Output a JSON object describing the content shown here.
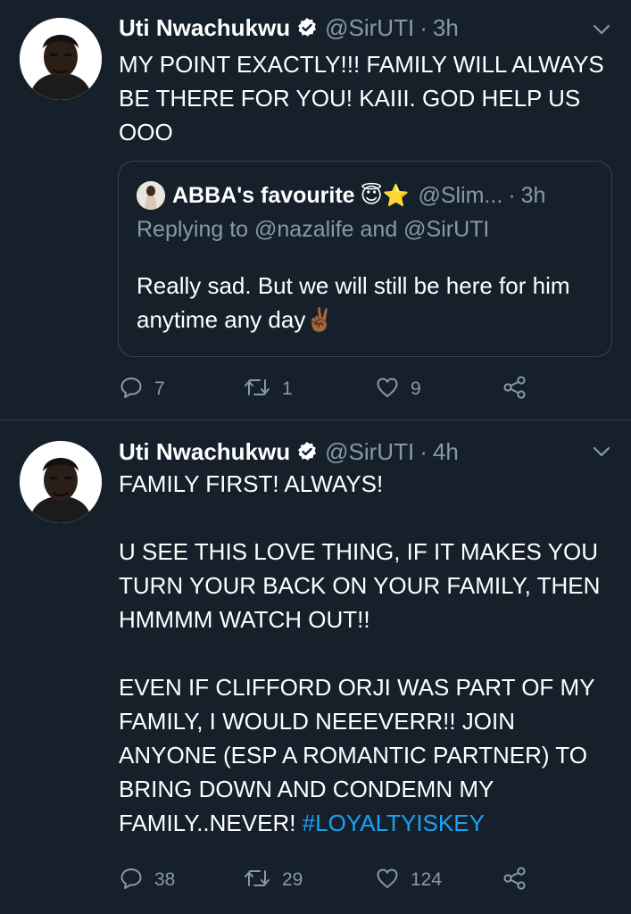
{
  "tweets": [
    {
      "author": {
        "name": "Uti Nwachukwu",
        "handle": "@SirUTI",
        "verified": true
      },
      "time": "3h",
      "text": "MY POINT EXACTLY!!! FAMILY WILL ALWAYS BE THERE FOR YOU! KAIII. GOD HELP US OOO",
      "quote": {
        "author_name": "ABBA's favourite",
        "author_emoji": "😇⭐",
        "handle": "@Slim...",
        "time": "3h",
        "replying_to": "Replying to @nazalife and @SirUTI",
        "text": "Really sad. But we will still be here for him anytime any day",
        "text_emoji": "✌🏾"
      },
      "counts": {
        "replies": "7",
        "retweets": "1",
        "likes": "9"
      }
    },
    {
      "author": {
        "name": "Uti Nwachukwu",
        "handle": "@SirUTI",
        "verified": true
      },
      "time": "4h",
      "text": "FAMILY FIRST! ALWAYS!\n\nU SEE THIS LOVE THING, IF IT MAKES YOU TURN YOUR BACK ON YOUR FAMILY, THEN HMMMM WATCH OUT!!\n\nEVEN IF CLIFFORD ORJI WAS PART OF MY FAMILY, I WOULD NEEEVERR!! JOIN ANYONE (ESP A ROMANTIC PARTNER) TO BRING DOWN AND CONDEMN MY FAMILY..NEVER! ",
      "hashtag": "#LOYALTYISKEY",
      "counts": {
        "replies": "38",
        "retweets": "29",
        "likes": "124"
      }
    }
  ],
  "separator": "·",
  "colors": {
    "background": "#15202b",
    "secondary_text": "#8899a6",
    "link": "#1da1f2",
    "border": "#38444d",
    "verified_badge": "#ffffff"
  },
  "icons": {
    "reply": "reply-icon",
    "retweet": "retweet-icon",
    "like": "heart-icon",
    "share": "share-icon",
    "caret": "chevron-down-icon",
    "verified": "verified-badge-icon"
  }
}
